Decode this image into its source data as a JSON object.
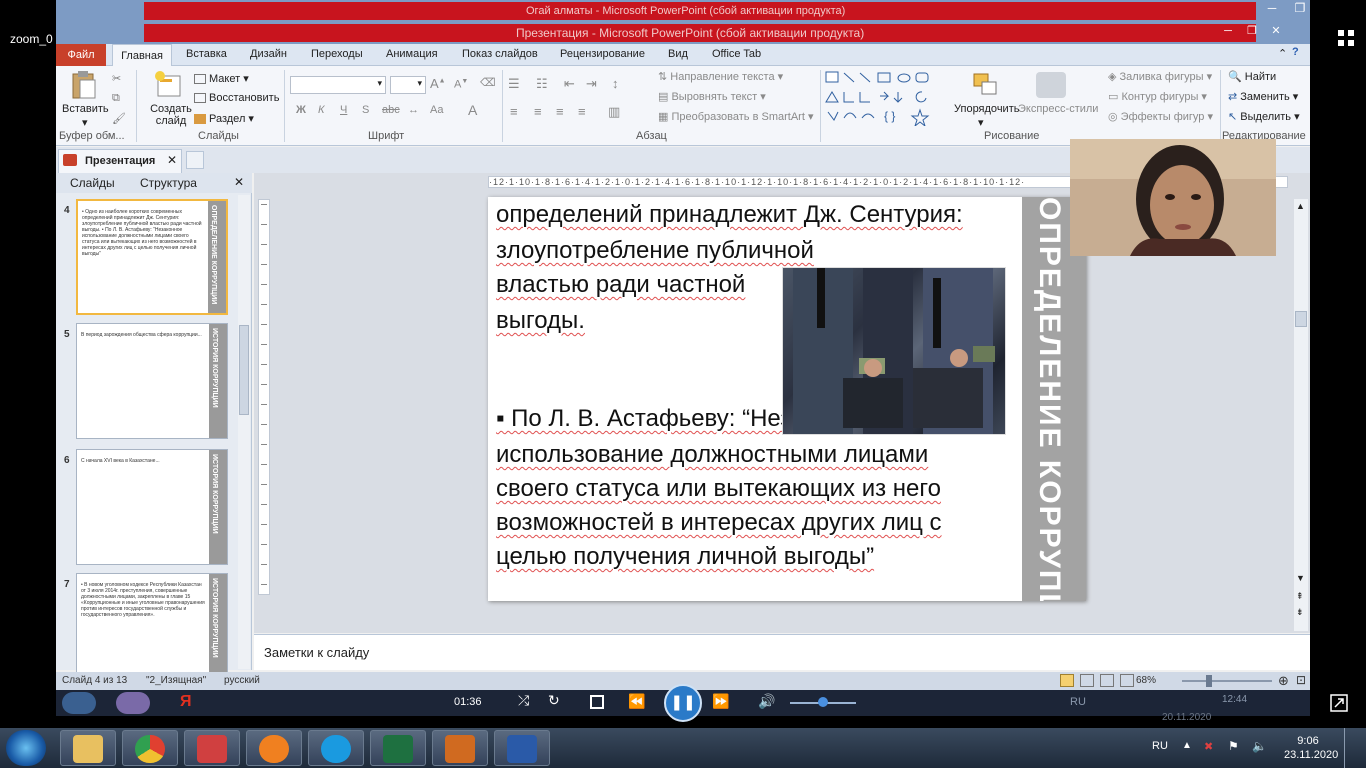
{
  "zoom": {
    "window_label": "zoom_0"
  },
  "window": {
    "title_top": "Огай алматы - Microsoft PowerPoint (сбой активации продукта)",
    "title": "Презентация - Microsoft PowerPoint (сбой активации продукта)"
  },
  "ribbon_tabs": [
    "Файл",
    "Главная",
    "Вставка",
    "Дизайн",
    "Переходы",
    "Анимация",
    "Показ слайдов",
    "Рецензирование",
    "Вид",
    "Office Tab"
  ],
  "ribbon": {
    "paste_label": "Вставить",
    "clipboard_group": "Буфер обм...",
    "new_slide_label": "Создать слайд",
    "layout_label": "Макет",
    "reset_label": "Восстановить",
    "section_label": "Раздел",
    "slides_group": "Слайды",
    "font_group": "Шрифт",
    "paragraph_group": "Абзац",
    "text_direction": "Направление текста",
    "align_text": "Выровнять текст",
    "smartart": "Преобразовать в SmartArt",
    "arrange_label": "Упорядочить",
    "quick_styles_label": "Экспресс-стили",
    "shape_fill": "Заливка фигуры",
    "shape_outline": "Контур фигуры",
    "shape_effects": "Эффекты фигур",
    "drawing_group": "Рисование",
    "find_label": "Найти",
    "replace_label": "Заменить",
    "select_label": "Выделить",
    "editing_group": "Редактирование",
    "bold": "Ж",
    "italic": "К",
    "underline": "Ч",
    "strike": "S",
    "abc": "abc",
    "aa": "Aa"
  },
  "doc_tab": {
    "label": "Презентация"
  },
  "panel": {
    "tab_slides": "Слайды",
    "tab_outline": "Структура"
  },
  "thumbnails": [
    {
      "num": "4",
      "band": "ОПРЕДЕЛЕНИЕ КОРРУПЦИИ",
      "text": "• Одно из наиболее коротких современных определений принадлежит Дж. Сентурия: злоупотребление публичной властью ради частной выгоды. • По Л. В. Астафьеву: “Незаконное использование должностными лицами своего статуса или вытекающих из него возможностей в интересах других лиц с целью получения личной выгоды”"
    },
    {
      "num": "5",
      "band": "ИСТОРИЯ КОРРУПЦИИ",
      "text": "В период зарождения общества сфера коррупции..."
    },
    {
      "num": "6",
      "band": "ИСТОРИЯ КОРРУПЦИИ",
      "text": "С начала XVI века в Казахстане..."
    },
    {
      "num": "7",
      "band": "ИСТОРИЯ КОРРУПЦИИ",
      "text": "• В новом уголовном кодексе Республики Казахстан от 3 июля 2014г. преступления, совершенные должностными лицами, закреплены в главе 15 «Коррупционные и иные уголовные правонарушения против интересов государственной службы и государственного управления»."
    }
  ],
  "slide": {
    "band_text": "ОПРЕДЕЛЕНИЕ КОРРУПЦИИ",
    "lines": [
      "определений принадлежит Дж. Сентурия:",
      "злоупотребление публичной",
      "властью ради частной",
      "выгоды.",
      "▪ По Л. В. Астафьеву: “Незаконное",
      "использование должностными лицами",
      "своего статуса или вытекающих из него",
      "возможностей в интересах других лиц с",
      "целью получения личной выгоды”"
    ]
  },
  "notes": {
    "placeholder": "Заметки к слайду"
  },
  "status": {
    "slide_of": "Слайд 4 из 13",
    "theme": "\"2_Изящная\"",
    "language": "русский",
    "zoom": "68%"
  },
  "player": {
    "time": "01:36"
  },
  "taskbar": {
    "language": "RU",
    "time": "9:06",
    "date": "23.11.2020",
    "ghost_time": "12:44",
    "ghost_date": "20.11.2020"
  }
}
